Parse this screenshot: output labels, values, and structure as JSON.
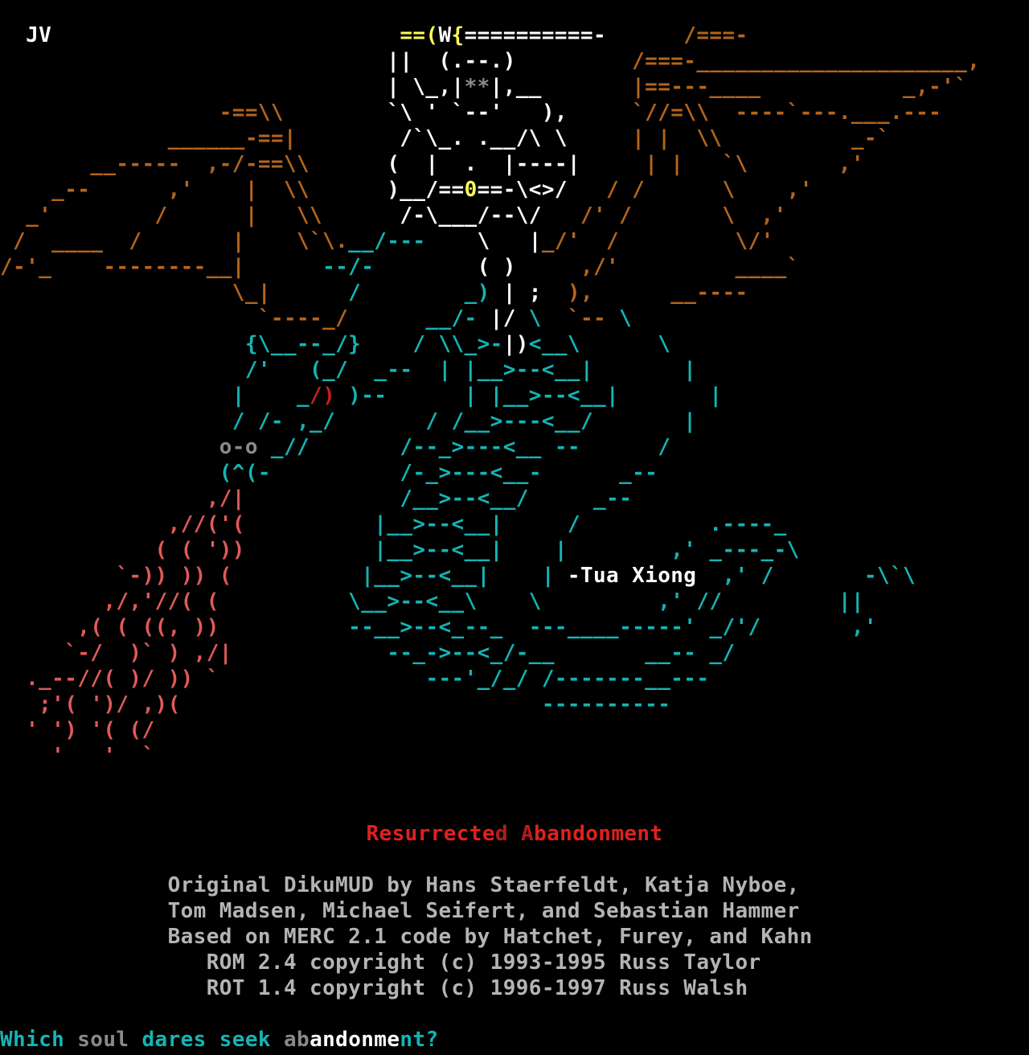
{
  "art": {
    "signature": "-Tua Xiong",
    "lines": [
      [
        {
          "t": "  JV                           ",
          "c": "white"
        },
        {
          "t": "==(",
          "c": "yellow"
        },
        {
          "t": "W",
          "c": "white"
        },
        {
          "t": "{",
          "c": "yellow"
        },
        {
          "t": "==========-",
          "c": "white"
        },
        {
          "t": "      /===-",
          "c": "brown"
        }
      ],
      [
        {
          "t": "                              ||  (.--.)         ",
          "c": "white"
        },
        {
          "t": "/===-_____________________,",
          "c": "brown"
        }
      ],
      [
        {
          "t": "                              | \\_,|",
          "c": "white"
        },
        {
          "t": "**",
          "c": "grey"
        },
        {
          "t": "|,__       ",
          "c": "white"
        },
        {
          "t": "|==---____           _,-'`",
          "c": "brown"
        }
      ],
      [
        {
          "t": "                 -==\\\\        ",
          "c": "brown"
        },
        {
          "t": "`\\ ' `--'   ),     ",
          "c": "white"
        },
        {
          "t": "`//=\\\\  ----`---.___.---",
          "c": "brown"
        }
      ],
      [
        {
          "t": "             ______-==|        ",
          "c": "brown"
        },
        {
          "t": "/`\\_. .__/\\ \\     ",
          "c": "white"
        },
        {
          "t": "| |  \\\\          _-`",
          "c": "brown"
        }
      ],
      [
        {
          "t": "       __-----  ,-/-==\\\\      ",
          "c": "brown"
        },
        {
          "t": "(  |  .  |----|     ",
          "c": "white"
        },
        {
          "t": "| |   `\\       ,'",
          "c": "brown"
        }
      ],
      [
        {
          "t": "    _--      ,'    |  \\\\      ",
          "c": "brown"
        },
        {
          "t": ")__/==",
          "c": "white"
        },
        {
          "t": "0",
          "c": "yellow"
        },
        {
          "t": "==-\\<>/   ",
          "c": "white"
        },
        {
          "t": "/ /      \\    ,'",
          "c": "brown"
        }
      ],
      [
        {
          "t": "  _'        /      |   \\\\      ",
          "c": "brown"
        },
        {
          "t": "/-\\___/--\\/   ",
          "c": "white"
        },
        {
          "t": "/' /       \\  ,'",
          "c": "brown"
        }
      ],
      [
        {
          "t": " /  ____  /       |    \\`\\.",
          "c": "brown"
        },
        {
          "t": "__/---",
          "c": "cyan"
        },
        {
          "t": "    \\   |",
          "c": "white"
        },
        {
          "t": "_/'  /         \\/'",
          "c": "brown"
        }
      ],
      [
        {
          "t": "/-'_    --------__|    ",
          "c": "brown"
        },
        {
          "t": "  --/-",
          "c": "cyan"
        },
        {
          "t": "        ( )     ",
          "c": "white"
        },
        {
          "t": ",/'         ____`",
          "c": "brown"
        }
      ],
      [
        {
          "t": "                  \\_|    ",
          "c": "brown"
        },
        {
          "t": "  /        _)",
          "c": "cyan"
        },
        {
          "t": " | ;  ",
          "c": "white"
        },
        {
          "t": "),      __----",
          "c": "brown"
        }
      ],
      [
        {
          "t": "                    `----_/    ",
          "c": "brown"
        },
        {
          "t": "  __/-",
          "c": "cyan"
        },
        {
          "t": " |/ ",
          "c": "white"
        },
        {
          "t": "\\ ",
          "c": "cyan"
        },
        {
          "t": " `--",
          "c": "brown"
        },
        {
          "t": " \\",
          "c": "cyan"
        }
      ],
      [
        {
          "t": "                   {\\__--_/}    / \\\\_>-",
          "c": "cyan"
        },
        {
          "t": "|)",
          "c": "white"
        },
        {
          "t": "<__\\      \\",
          "c": "cyan"
        }
      ],
      [
        {
          "t": "                   /'   (_/  _--  | |__>--<__|       |",
          "c": "cyan"
        }
      ],
      [
        {
          "t": "                  |    _",
          "c": "cyan"
        },
        {
          "t": "/)",
          "c": "dred"
        },
        {
          "t": " )--      | |__>--<__|       |",
          "c": "cyan"
        }
      ],
      [
        {
          "t": "                  / /- ,_/       / /__>---<__/       |",
          "c": "cyan"
        }
      ],
      [
        {
          "t": "                 ",
          "c": "cyan"
        },
        {
          "t": "o-o",
          "c": "grey"
        },
        {
          "t": " _//       /--_>---<__ --      /",
          "c": "cyan"
        }
      ],
      [
        {
          "t": "                 (^(-          /-_>---<__-      _--",
          "c": "cyan"
        }
      ],
      [
        {
          "t": "                ,/|",
          "c": "red"
        },
        {
          "t": "            /__>--<__/     _--",
          "c": "cyan"
        }
      ],
      [
        {
          "t": "             ,//('(",
          "c": "red"
        },
        {
          "t": "          |__>--<__|     /          .----_",
          "c": "cyan"
        }
      ],
      [
        {
          "t": "            ( ( '))",
          "c": "red"
        },
        {
          "t": "          |__>--<__|    |        ,' _---_-\\",
          "c": "cyan"
        }
      ],
      [
        {
          "t": "         `-)) )) (",
          "c": "red"
        },
        {
          "t": "          |__>--<__|    | ",
          "c": "cyan"
        },
        {
          "t": "-Tua Xiong",
          "c": "white",
          "role": "signature"
        },
        {
          "t": "  ,' /       -\\`\\",
          "c": "cyan"
        }
      ],
      [
        {
          "t": "        ,/,'//( (",
          "c": "red"
        },
        {
          "t": "          \\__>--<__\\    \\         ,' //         ||",
          "c": "cyan"
        }
      ],
      [
        {
          "t": "      ,( ( ((, ))",
          "c": "red"
        },
        {
          "t": "          --__>--<_--_  ---____-----' _/'/       ,'",
          "c": "cyan"
        }
      ],
      [
        {
          "t": "     `-/  )` ) ,/|",
          "c": "red"
        },
        {
          "t": "            --_->--<_/-__       __-- _/",
          "c": "cyan"
        }
      ],
      [
        {
          "t": "  ._--//( )/ )) `",
          "c": "red"
        },
        {
          "t": "                ---'_/_/ /-------__---",
          "c": "cyan"
        }
      ],
      [
        {
          "t": "   ;'( ')/ ,)(",
          "c": "red"
        },
        {
          "t": "                            ----------",
          "c": "cyan"
        }
      ],
      [
        {
          "t": "  ' ') '( (/",
          "c": "red"
        }
      ],
      [
        {
          "t": "    '   '  `",
          "c": "red"
        }
      ]
    ]
  },
  "title": {
    "parts": [
      {
        "t": "Resurrecte",
        "c": "r1"
      },
      {
        "t": "d",
        "c": "r2"
      },
      {
        "t": " ",
        "c": "r1"
      },
      {
        "t": "A",
        "c": "r2"
      },
      {
        "t": "bandonment",
        "c": "r1"
      }
    ]
  },
  "credits": [
    "             Original DikuMUD by Hans Staerfeldt, Katja Nyboe,",
    "             Tom Madsen, Michael Seifert, and Sebastian Hammer",
    "             Based on MERC 2.1 code by Hatchet, Furey, and Kahn",
    "                ROM 2.4 copyright (c) 1993-1995 Russ Taylor",
    "                ROT 1.4 copyright (c) 1996-1997 Russ Walsh"
  ],
  "prompt": {
    "parts": [
      {
        "t": "Which ",
        "c": "p-cyan"
      },
      {
        "t": "soul ",
        "c": "p-grey"
      },
      {
        "t": "dares seek ",
        "c": "p-cyan"
      },
      {
        "t": "ab",
        "c": "p-grey"
      },
      {
        "t": "andonme",
        "c": "p-white"
      },
      {
        "t": "nt?",
        "c": "p-cyan"
      }
    ]
  },
  "colors": {
    "background": "#000000",
    "white": "#ffffff",
    "grey": "#8a8a8a",
    "yellow": "#ffff55",
    "brown": "#b5651d",
    "cyan": "#14b4b4",
    "red": "#e05a5a",
    "dark_red": "#c81e1e",
    "credits": "#b4b4b4",
    "title_red": "#e02020"
  }
}
